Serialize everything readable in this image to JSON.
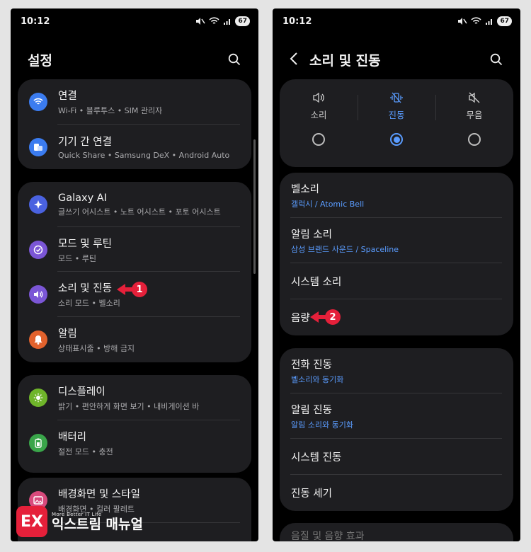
{
  "left": {
    "status": {
      "time": "10:12",
      "battery": "67"
    },
    "header": {
      "title": "설정"
    },
    "groups": [
      [
        {
          "title": "연결",
          "subtitle": "Wi-Fi • 블루투스 • SIM 관리자",
          "icon": "wifi-icon",
          "color": "#3b7cf0"
        },
        {
          "title": "기기 간 연결",
          "subtitle": "Quick Share • Samsung DeX • Android Auto",
          "icon": "devices-icon",
          "color": "#3b7cf0"
        }
      ],
      [
        {
          "title": "Galaxy AI",
          "subtitle": "글쓰기 어시스트 • 노트 어시스트 • 포토 어시스트",
          "icon": "sparkle-icon",
          "color": "#4a62e0"
        },
        {
          "title": "모드 및 루틴",
          "subtitle": "모드 • 루틴",
          "icon": "routine-icon",
          "color": "#7b56d6"
        },
        {
          "title": "소리 및 진동",
          "subtitle": "소리 모드 • 벨소리",
          "icon": "sound-icon",
          "color": "#7b56d6"
        },
        {
          "title": "알림",
          "subtitle": "상태표시줄 • 방해 금지",
          "icon": "bell-icon",
          "color": "#e2622d"
        }
      ],
      [
        {
          "title": "디스플레이",
          "subtitle": "밝기 • 편안하게 화면 보기 • 내비게이션 바",
          "icon": "sun-icon",
          "color": "#6fb52a"
        },
        {
          "title": "배터리",
          "subtitle": "절전 모드 • 충전",
          "icon": "battery-icon",
          "color": "#3aa54a"
        }
      ],
      [
        {
          "title": "배경화면 및 스타일",
          "subtitle": "배경화면 • 컬러 팔레트",
          "icon": "image-icon",
          "color": "#d84a7c"
        }
      ]
    ],
    "annotation": "1"
  },
  "right": {
    "status": {
      "time": "10:12",
      "battery": "67"
    },
    "header": {
      "title": "소리 및 진동"
    },
    "modes": [
      {
        "label": "소리",
        "icon": "speaker-icon",
        "selected": false
      },
      {
        "label": "진동",
        "icon": "vibrate-icon",
        "selected": true
      },
      {
        "label": "무음",
        "icon": "mute-icon",
        "selected": false
      }
    ],
    "group1": [
      {
        "title": "벨소리",
        "subtitle": "갤럭시 / Atomic Bell"
      },
      {
        "title": "알림 소리",
        "subtitle": "삼성 브랜드 사운드 / Spaceline"
      },
      {
        "title": "시스템 소리",
        "subtitle": ""
      },
      {
        "title": "음량",
        "subtitle": ""
      }
    ],
    "group2": [
      {
        "title": "전화 진동",
        "subtitle": "벨소리와 동기화"
      },
      {
        "title": "알림 진동",
        "subtitle": "알림 소리와 동기화"
      },
      {
        "title": "시스템 진동",
        "subtitle": ""
      },
      {
        "title": "진동 세기",
        "subtitle": ""
      }
    ],
    "partial_item": "음질 및 음향 효과",
    "annotation": "2"
  },
  "watermark": {
    "mark": "EX",
    "tagline": "More Better IT Life",
    "name": "익스트림 매뉴얼"
  },
  "colors": {
    "accent_blue": "#5a9cff",
    "annotation_red": "#e5203a",
    "card_bg": "#1e1e21"
  }
}
